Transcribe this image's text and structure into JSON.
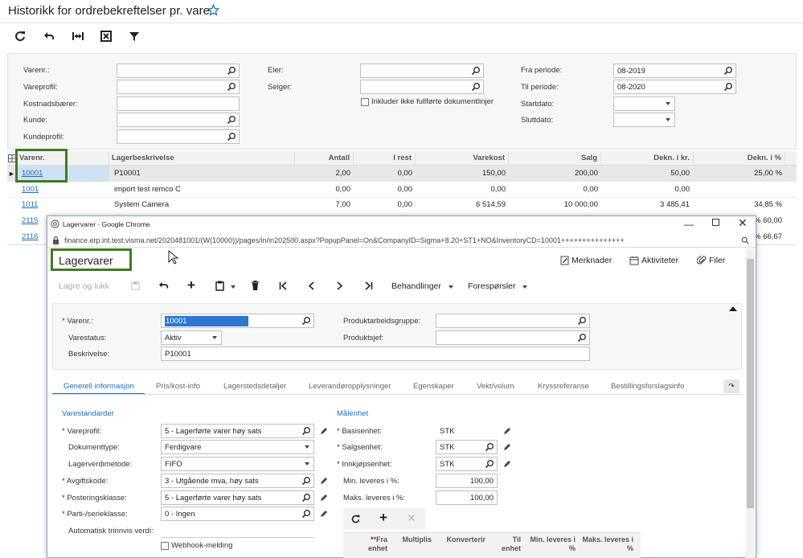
{
  "page": {
    "title": "Historikk for ordrebekreftelser pr. vare"
  },
  "filters": {
    "varenr_label": "Varenr.:",
    "vareprofil_label": "Vareprofil:",
    "kostnadsbaerer_label": "Kostnadsbærer:",
    "kunde_label": "Kunde:",
    "kundeprofil_label": "Kundeprofil:",
    "eier_label": "Eier:",
    "selger_label": "Selger:",
    "include_label": "Inkluder ikke fullførte dokumentlinjer",
    "fra_periode_label": "Fra periode:",
    "fra_periode_value": "08-2019",
    "til_periode_label": "Til periode:",
    "til_periode_value": "08-2020",
    "startdato_label": "Startdato:",
    "sluttdato_label": "Sluttdato:"
  },
  "grid": {
    "headers": [
      "Varenr.",
      "Lagerbeskrivelse",
      "Antall",
      "I rest",
      "Varekost",
      "Salg",
      "Dekn. i kr.",
      "Dekn. i %"
    ],
    "rows": [
      {
        "varenr": "10001",
        "desc": "P10001",
        "antall": "2,00",
        "irest": "0,00",
        "varekost": "150,00",
        "salg": "200,00",
        "dekn_kr": "50,00",
        "dekn_pct": "25,00 %"
      },
      {
        "varenr": "1001",
        "desc": "import test remco C",
        "antall": "0,00",
        "irest": "0,00",
        "varekost": "0,00",
        "salg": "0,00",
        "dekn_kr": "0,00",
        "dekn_pct": ""
      },
      {
        "varenr": "1011",
        "desc": "System Camera",
        "antall": "7,00",
        "irest": "0,00",
        "varekost": "6 514,59",
        "salg": "10 000,00",
        "dekn_kr": "3 485,41",
        "dekn_pct": "34,85 %"
      },
      {
        "varenr": "2115",
        "dekn_pct": "60,00 %"
      },
      {
        "varenr": "2116",
        "dekn_pct": "66,67 %"
      }
    ]
  },
  "popup": {
    "window_title": "Lagervarer - Google Chrome",
    "url": "finance.erp.int.test.visma.net/2020481001/(W(10000))/pages/in/in202500.aspx?PopupPanel=On&CompanyID=Sigma+8.20+ST1+NO&InventoryCD=10001+++++++++++++++",
    "screen_title": "Lagervarer",
    "merknader": "Merknader",
    "aktiviteter": "Aktiviteter",
    "filer": "Filer",
    "lagre_og_lukk": "Lagre og lukk",
    "behandlinger": "Behandlinger",
    "forespoersler": "Forespørsler",
    "varenr_label": "Varenr.:",
    "varenr_value": "10001",
    "varestatus_label": "Varestatus:",
    "varestatus_value": "Aktiv",
    "beskrivelse_label": "Beskrivelse:",
    "beskrivelse_value": "P10001",
    "produktarbeidsgruppe_label": "Produktarbeidsgruppe:",
    "produktsjef_label": "Produktsjef:",
    "tabs": [
      "Generell informasjon",
      "Pris/kost-info",
      "Lagerstedsdetaljer",
      "Leverandøropplysninger",
      "Egenskaper",
      "Vekt/volum",
      "Kryssreferanse",
      "Bestillingsforslagsinfo"
    ],
    "varestandarder_title": "Varestandarder",
    "vareprofil_label": "Vareprofil:",
    "vareprofil_value": "5 - Lagerførte varer høy sats",
    "dokumenttype_label": "Dokumenttype:",
    "dokumenttype_value": "Ferdigvare",
    "lagerverdimetode_label": "Lagerverdimetode:",
    "lagerverdimetode_value": "FIFO",
    "avgiftskode_label": "Avgiftskode:",
    "avgiftskode_value": "3 - Utgående mva, høy sats",
    "posteringsklasse_label": "Posteringsklasse:",
    "posteringsklasse_value": "5 - Lagerførte varer høy sats",
    "parti_label": "Parti-/serieklasse:",
    "parti_value": "0 - Ingen",
    "auto_label": "Automatisk trinnvis verdi:",
    "webhook_label": "Webhook-melding",
    "maalenhet_title": "Målenhet",
    "basisenhet_label": "Basisenhet:",
    "basisenhet_value": "STK",
    "salgsenhet_label": "Salgsenhet:",
    "salgsenhet_value": "STK",
    "innkjopsenhet_label": "Innkjøpsenhet:",
    "innkjopsenhet_value": "STK",
    "min_label": "Min. leveres i %:",
    "min_value": "100,00",
    "maks_label": "Maks. leveres i %:",
    "maks_value": "100,00",
    "subgrid_headers": [
      "*Fra enhet",
      "Multiplis",
      "Konverterir",
      "Til enhet",
      "Min. leveres i %",
      "Maks. leveres i %"
    ]
  }
}
